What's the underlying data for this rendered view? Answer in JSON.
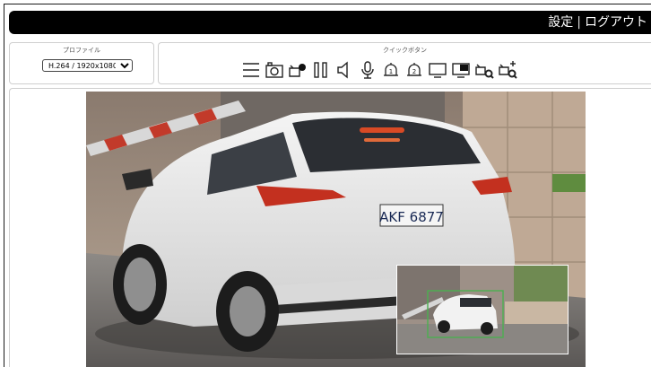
{
  "header": {
    "settings_link": "設定",
    "separator": "|",
    "logout_link": "ログアウト"
  },
  "profile": {
    "title": "プロファイル",
    "selected": "H.264 / 1920x1080",
    "options": [
      "H.264 / 1920x1080"
    ]
  },
  "quick_buttons": {
    "title": "クイックボタン",
    "icons": [
      "menu-icon",
      "snapshot-camera-icon",
      "record-camera-icon",
      "pause-icon",
      "speaker-icon",
      "microphone-icon",
      "alarm-1-icon",
      "alarm-2-icon",
      "single-screen-icon",
      "pip-screen-icon",
      "zoom-search-icon",
      "zoom-add-icon"
    ]
  },
  "video": {
    "plate_text": "AKF 6877"
  }
}
